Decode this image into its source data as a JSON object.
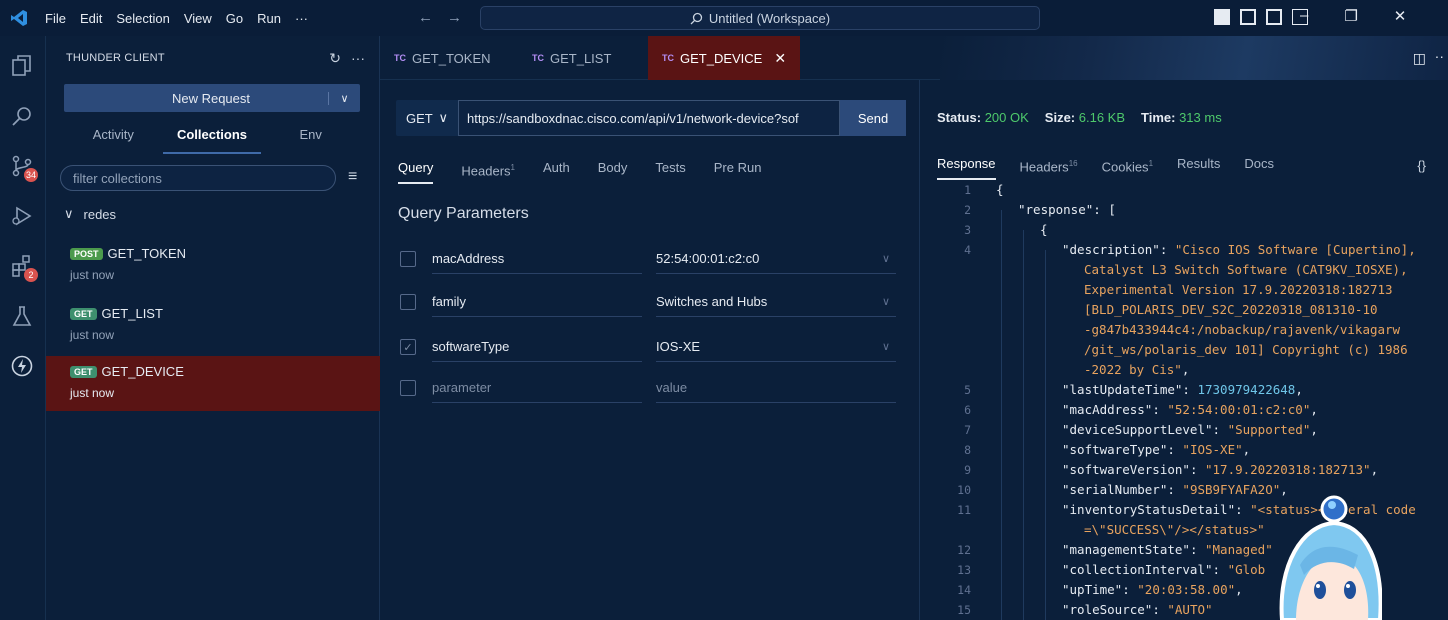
{
  "menu": [
    "File",
    "Edit",
    "Selection",
    "View",
    "Go",
    "Run",
    "···"
  ],
  "window": {
    "title": "Untitled (Workspace)"
  },
  "activity": {
    "source_control_badge": "34",
    "extensions_badge": "2"
  },
  "sidebar": {
    "header": "THUNDER CLIENT",
    "new_request": "New Request",
    "tabs": [
      "Activity",
      "Collections",
      "Env"
    ],
    "active_tab": "Collections",
    "filter_placeholder": "filter collections",
    "folder": "redes",
    "requests": [
      {
        "method": "POST",
        "name": "GET_TOKEN",
        "time": "just now"
      },
      {
        "method": "GET",
        "name": "GET_LIST",
        "time": "just now"
      },
      {
        "method": "GET",
        "name": "GET_DEVICE",
        "time": "just now"
      }
    ]
  },
  "editor_tabs": [
    {
      "badge": "TC",
      "label": "GET_TOKEN"
    },
    {
      "badge": "TC",
      "label": "GET_LIST"
    },
    {
      "badge": "TC",
      "label": "GET_DEVICE",
      "active": true
    }
  ],
  "request": {
    "method": "GET",
    "url": "https://sandboxdnac.cisco.com/api/v1/network-device?sof",
    "send": "Send",
    "tabs": [
      {
        "label": "Query",
        "sup": ""
      },
      {
        "label": "Headers",
        "sup": "1"
      },
      {
        "label": "Auth",
        "sup": ""
      },
      {
        "label": "Body",
        "sup": ""
      },
      {
        "label": "Tests",
        "sup": ""
      },
      {
        "label": "Pre Run",
        "sup": ""
      }
    ],
    "query_title": "Query Parameters",
    "params": [
      {
        "key": "macAddress",
        "value": "52:54:00:01:c2:c0",
        "checked": false
      },
      {
        "key": "family",
        "value": "Switches and Hubs",
        "checked": false
      },
      {
        "key": "softwareType",
        "value": "IOS-XE",
        "checked": true
      }
    ],
    "param_placeholder_key": "parameter",
    "param_placeholder_value": "value"
  },
  "response": {
    "status_label": "Status:",
    "status_value": "200 OK",
    "size_label": "Size:",
    "size_value": "6.16 KB",
    "time_label": "Time:",
    "time_value": "313 ms",
    "tabs": [
      {
        "label": "Response",
        "sup": ""
      },
      {
        "label": "Headers",
        "sup": "16"
      },
      {
        "label": "Cookies",
        "sup": "1"
      },
      {
        "label": "Results",
        "sup": ""
      },
      {
        "label": "Docs",
        "sup": ""
      }
    ],
    "braces": "{}",
    "lines": [
      {
        "n": "1",
        "indent": 0,
        "text": "{"
      },
      {
        "n": "2",
        "indent": 1,
        "key": "\"response\"",
        "rest": ": ["
      },
      {
        "n": "3",
        "indent": 2,
        "text": "{"
      },
      {
        "n": "4",
        "indent": 3,
        "key": "\"description\"",
        "str": "\"Cisco IOS Software [Cupertino],",
        "rest": ": "
      },
      {
        "n": "",
        "indent": 4,
        "str": "Catalyst L3 Switch Software (CAT9KV_IOSXE),"
      },
      {
        "n": "",
        "indent": 4,
        "str": "Experimental Version 17.9.20220318:182713"
      },
      {
        "n": "",
        "indent": 4,
        "str": "[BLD_POLARIS_DEV_S2C_20220318_081310-10"
      },
      {
        "n": "",
        "indent": 4,
        "str": "-g847b433944c4:/nobackup/rajavenk/vikagarw"
      },
      {
        "n": "",
        "indent": 4,
        "str": "/git_ws/polaris_dev 101] Copyright (c) 1986"
      },
      {
        "n": "",
        "indent": 4,
        "str": "-2022 by Cis\"",
        "rest": ","
      },
      {
        "n": "5",
        "indent": 3,
        "key": "\"lastUpdateTime\"",
        "rest": ": ",
        "num": "1730979422648",
        "tail": ","
      },
      {
        "n": "6",
        "indent": 3,
        "key": "\"macAddress\"",
        "rest": ": ",
        "str": "\"52:54:00:01:c2:c0\"",
        "tail": ","
      },
      {
        "n": "7",
        "indent": 3,
        "key": "\"deviceSupportLevel\"",
        "rest": ": ",
        "str": "\"Supported\"",
        "tail": ","
      },
      {
        "n": "8",
        "indent": 3,
        "key": "\"softwareType\"",
        "rest": ": ",
        "str": "\"IOS-XE\"",
        "tail": ","
      },
      {
        "n": "9",
        "indent": 3,
        "key": "\"softwareVersion\"",
        "rest": ": ",
        "str": "\"17.9.20220318:182713\"",
        "tail": ","
      },
      {
        "n": "10",
        "indent": 3,
        "key": "\"serialNumber\"",
        "rest": ": ",
        "str": "\"9SB9FYAFA2O\"",
        "tail": ","
      },
      {
        "n": "11",
        "indent": 3,
        "key": "\"inventoryStatusDetail\"",
        "rest": ": ",
        "str": "\"<status><general code"
      },
      {
        "n": "",
        "indent": 4,
        "str": "=\\\"SUCCESS\\\"/></status>\""
      },
      {
        "n": "12",
        "indent": 3,
        "key": "\"managementState\"",
        "rest": ": ",
        "str": "\"Managed\""
      },
      {
        "n": "13",
        "indent": 3,
        "key": "\"collectionInterval\"",
        "rest": ": ",
        "str": "\"Glob"
      },
      {
        "n": "14",
        "indent": 3,
        "key": "\"upTime\"",
        "rest": ": ",
        "str": "\"20:03:58.00\"",
        "tail": ","
      },
      {
        "n": "15",
        "indent": 3,
        "key": "\"roleSource\"",
        "rest": ": ",
        "str": "\"AUTO\""
      }
    ]
  },
  "colors": {
    "accent": "#2c4a7a",
    "selected": "#5a1414",
    "status_ok": "#4ec96b",
    "json_string": "#e8a35f",
    "json_number": "#6fc6e8"
  }
}
